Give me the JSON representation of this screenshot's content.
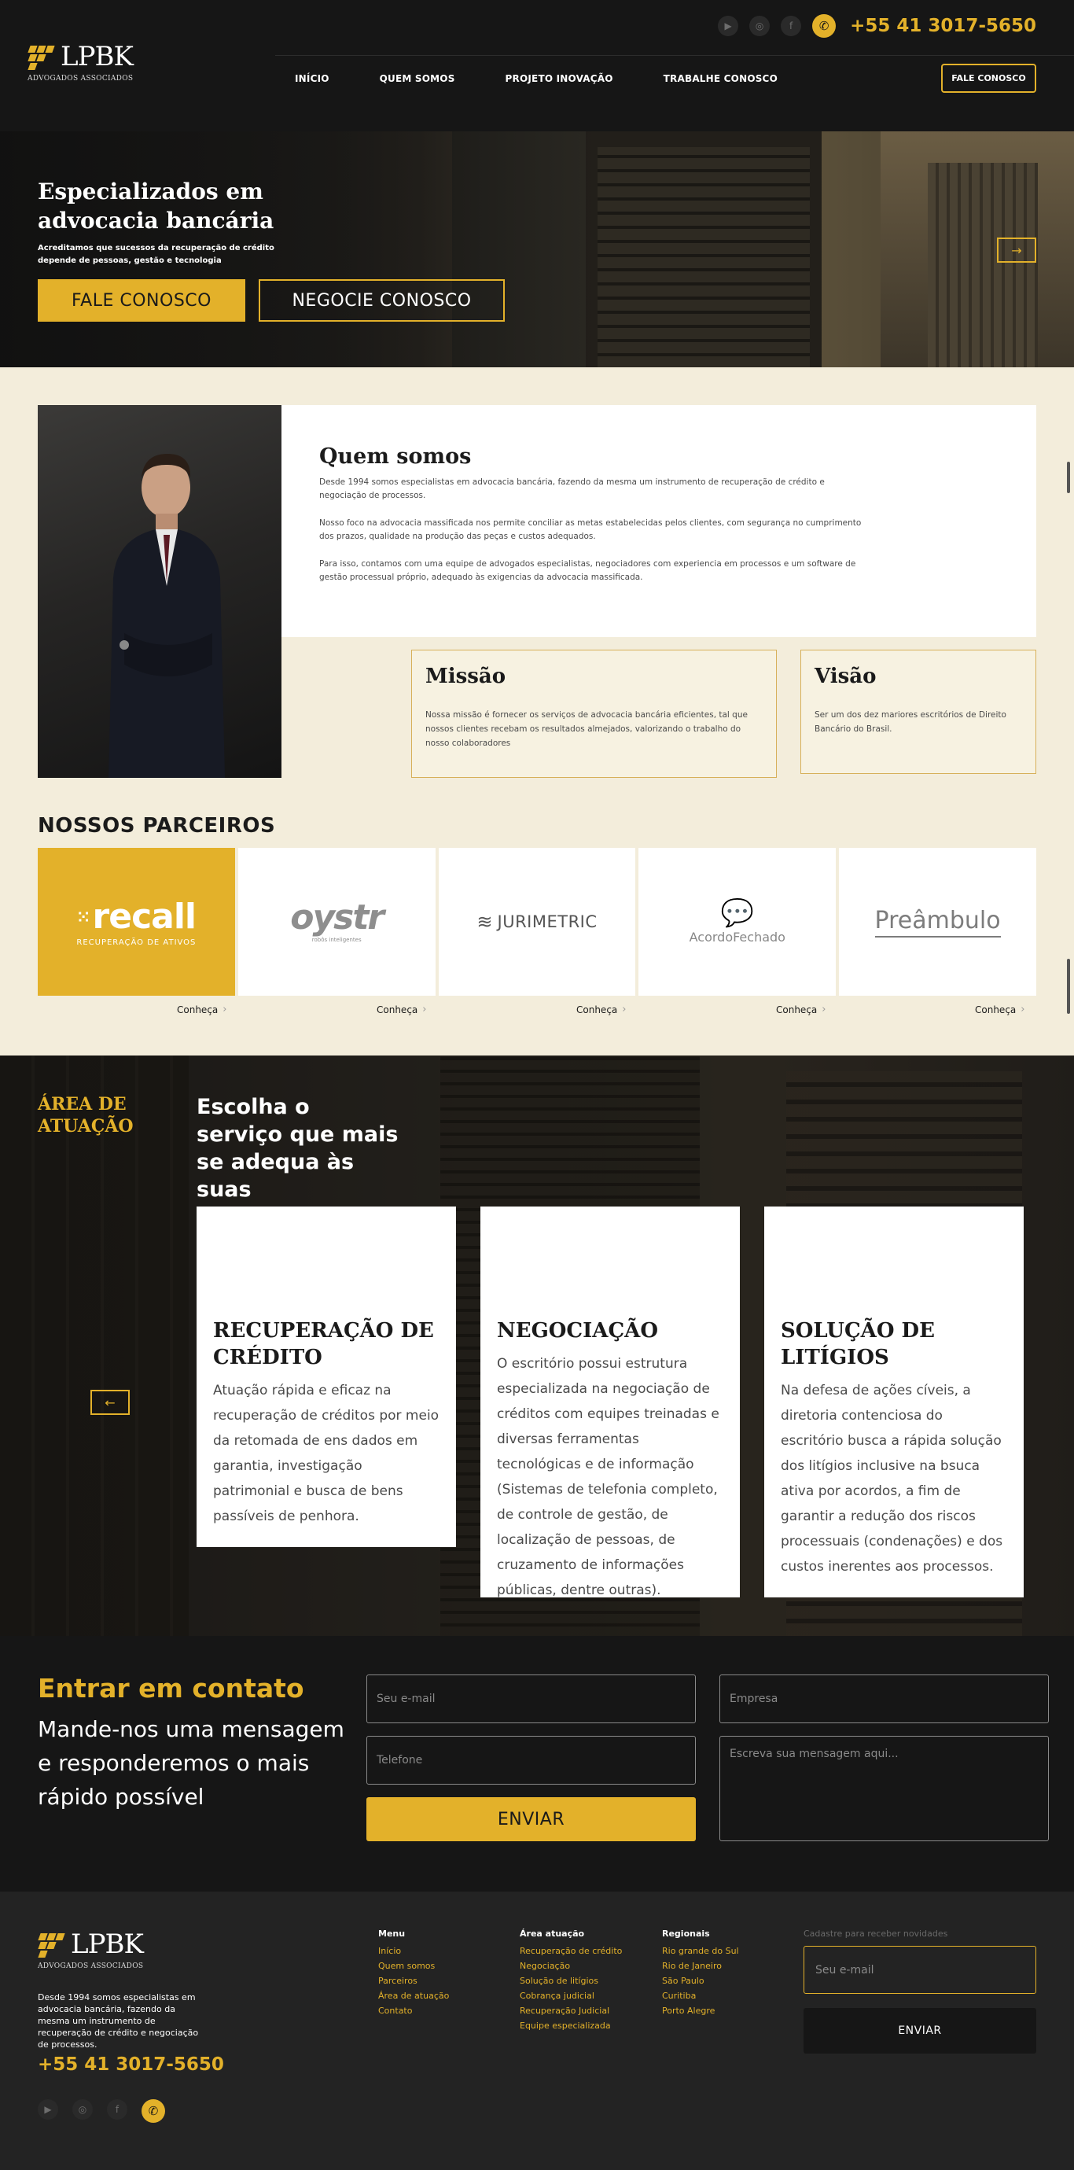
{
  "brand": {
    "name": "LPBK",
    "tagline": "ADVOGADOS ASSOCIADOS",
    "accent": "#e3b12a",
    "dark": "#161616",
    "cream": "#f3eddb"
  },
  "header": {
    "phone": "+55 41 3017-5650",
    "social_icons": [
      "youtube-icon",
      "instagram-icon",
      "facebook-icon",
      "whatsapp-icon"
    ],
    "nav": [
      "INÍCIO",
      "QUEM SOMOS",
      "PROJETO INOVAÇÃO",
      "TRABALHE CONOSCO"
    ],
    "cta": "FALE CONOSCO"
  },
  "hero": {
    "title": "Especializados em advocacia bancária",
    "subtitle": "Acreditamos que sucessos da recuperação de crédito depende de pessoas, gestão e tecnologia",
    "btn_primary": "FALE CONOSCO",
    "btn_secondary": "NEGOCIE CONOSCO",
    "next_arrow": "→"
  },
  "about": {
    "title": "Quem somos",
    "paragraphs": [
      "Desde 1994 somos especialistas em advocacia bancária, fazendo da mesma um instrumento de recuperação de crédito e negociação de processos.",
      "Nosso foco na advocacia massificada nos permite conciliar as metas estabelecidas pelos clientes, com segurança no cumprimento dos prazos, qualidade na produção das peças e custos adequados.",
      "Para isso, contamos com uma equipe de advogados especialistas, negociadores com experiencia em processos e um software de gestão processual próprio, adequado às exigencias da advocacia massificada."
    ],
    "mission": {
      "title": "Missão",
      "text": "Nossa missão é fornecer os serviços de advocacia bancária eficientes, tal que nossos clientes recebam os resultados almejados, valorizando o trabalho do nosso colaboradores"
    },
    "vision": {
      "title": "Visão",
      "text": "Ser um dos dez mariores escritórios de Direito Bancário do Brasil."
    }
  },
  "partners": {
    "title": "NOSSOS PARCEIROS",
    "items": [
      {
        "name": "recall",
        "sub": "RECUPERAÇÃO DE ATIVOS",
        "link": "Conheça"
      },
      {
        "name": "oystr",
        "sub": "robôs inteligentes",
        "link": "Conheça"
      },
      {
        "name": "JURIMETRIC",
        "sub": "",
        "link": "Conheça"
      },
      {
        "name": "AcordoFechado",
        "sub": "",
        "link": "Conheça"
      },
      {
        "name": "Preâmbulo",
        "sub": "",
        "link": "Conheça"
      }
    ]
  },
  "area": {
    "label": "ÁREA DE ATUAÇÃO",
    "heading": "Escolha o serviço que mais se adequa às suas necessidades.",
    "prev_arrow": "←",
    "services": [
      {
        "title": "RECUPERAÇÃO DE CRÉDITO",
        "text": "Atuação rápida e eficaz na recuperação de créditos por meio da retomada de ens dados em garantia, investigação patrimonial e busca de bens passíveis de penhora."
      },
      {
        "title": "NEGOCIAÇÃO",
        "text": "O escritório possui estrutura especializada na negociação de créditos com equipes treinadas e diversas ferramentas tecnológicas e de informação (Sistemas de telefonia completo, de controle de gestão, de localização de pessoas, de cruzamento de informações públicas, dentre outras)."
      },
      {
        "title": "SOLUÇÃO DE LITÍGIOS",
        "text": "Na defesa de ações cíveis, a diretoria contenciosa do escritório busca a rápida solução dos litígios inclusive na bsuca ativa por acordos, a fim de garantir a redução dos riscos processuais (condenações) e dos custos inerentes aos processos."
      }
    ]
  },
  "contact": {
    "title": "Entrar em contato",
    "subtitle": "Mande-nos uma mensagem e responderemos o mais rápido possível",
    "email_placeholder": "Seu e-mail",
    "company_placeholder": "Empresa",
    "phone_placeholder": "Telefone",
    "message_placeholder": "Escreva sua mensagem aqui...",
    "send": "ENVIAR"
  },
  "footer": {
    "description": "Desde 1994 somos especialistas em advocacia bancária, fazendo da mesma um instrumento de recuperação de crédito e negociação de processos.",
    "phone": "+55 41 3017-5650",
    "menu": {
      "title": "Menu",
      "items": [
        "Início",
        "Quem somos",
        "Parceiros",
        "Área de atuação",
        "Contato"
      ]
    },
    "areas": {
      "title": "Área atuação",
      "items": [
        "Recuperação de crédito",
        "Negociação",
        "Solução de litígios",
        "Cobrança judicial",
        "Recuperação Judicial",
        "Equipe especializada"
      ]
    },
    "regionais": {
      "title": "Regionais",
      "items": [
        "Rio grande do Sul",
        "Rio de Janeiro",
        "São Paulo",
        "Curitiba",
        "Porto Alegre"
      ]
    },
    "newsletter_label": "Cadastre para receber novidades",
    "newsletter_placeholder": "Seu e-mail",
    "newsletter_button": "ENVIAR"
  }
}
